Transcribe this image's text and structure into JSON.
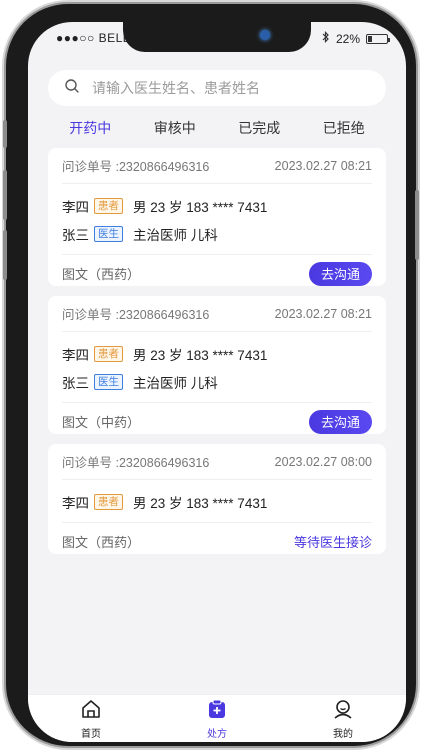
{
  "status": {
    "carrier": "●●●○○ BELL",
    "battery": "22%",
    "battery_level": 0.22
  },
  "search": {
    "placeholder": "请输入医生姓名、患者姓名"
  },
  "tabs": [
    {
      "label": "开药中"
    },
    {
      "label": "审核中"
    },
    {
      "label": "已完成"
    },
    {
      "label": "已拒绝"
    }
  ],
  "cards": [
    {
      "order_label": "问诊单号 :2320866496316",
      "datetime": "2023.02.27   08:21",
      "patient": {
        "name": "李四",
        "tag": "患者",
        "info": "男  23 岁   183 **** 7431"
      },
      "doctor": {
        "name": "张三",
        "tag": "医生",
        "info": "主治医师  儿科"
      },
      "type": "图文（西药）",
      "action": "去沟通"
    },
    {
      "order_label": "问诊单号 :2320866496316",
      "datetime": "2023.02.27   08:21",
      "patient": {
        "name": "李四",
        "tag": "患者",
        "info": "男  23 岁   183 **** 7431"
      },
      "doctor": {
        "name": "张三",
        "tag": "医生",
        "info": "主治医师  儿科"
      },
      "type": "图文（中药）",
      "action": "去沟通"
    },
    {
      "order_label": "问诊单号 :2320866496316",
      "datetime": "2023.02.27   08:00",
      "patient": {
        "name": "李四",
        "tag": "患者",
        "info": "男  23 岁   183 **** 7431"
      },
      "type": "图文（西药）",
      "status": "等待医生接诊"
    }
  ],
  "nav": [
    {
      "label": "首页",
      "icon": "home-icon"
    },
    {
      "label": "处方",
      "icon": "prescription-icon"
    },
    {
      "label": "我的",
      "icon": "profile-icon"
    }
  ],
  "colors": {
    "accent": "#4a38e0",
    "patient_tag": "#e39a3e",
    "doctor_tag": "#3d7fe0"
  }
}
